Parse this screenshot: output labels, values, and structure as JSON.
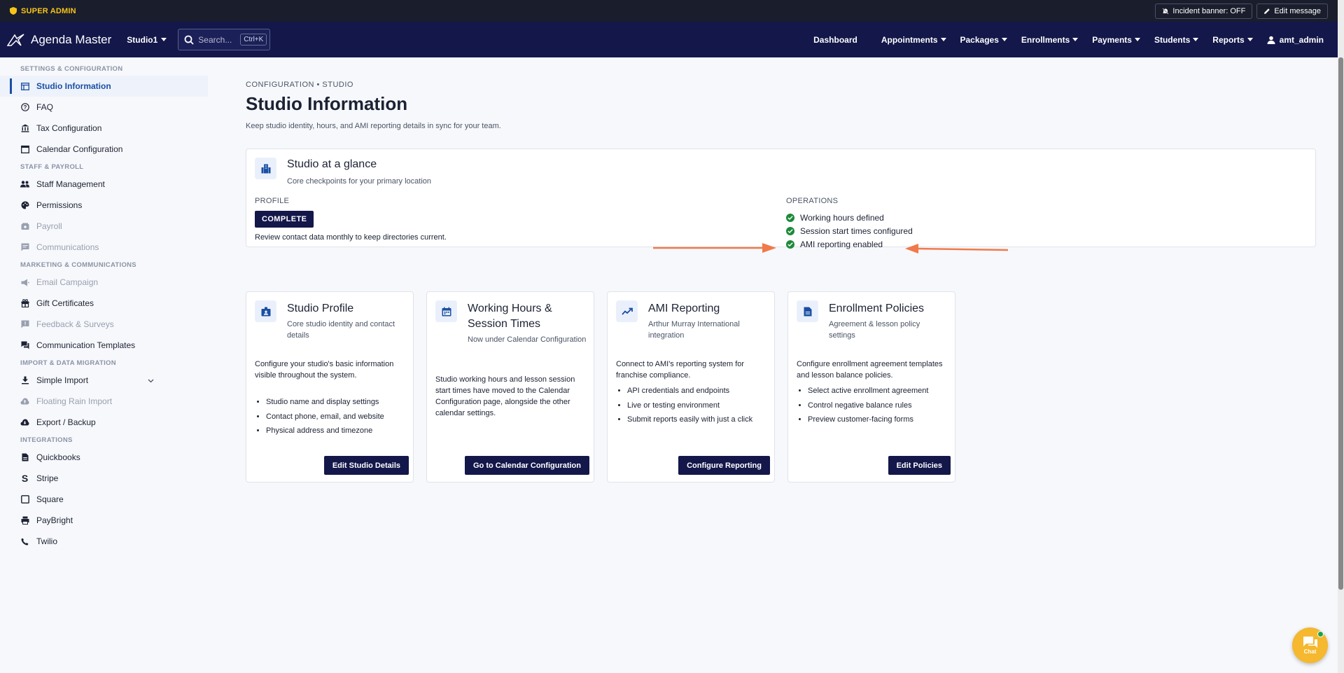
{
  "admin_bar": {
    "badge_label": "SUPER ADMIN",
    "incident_banner_label": "Incident banner: OFF",
    "edit_message_label": "Edit message"
  },
  "nav": {
    "brand": "Agenda Master",
    "studio": "Studio1",
    "search_placeholder": "Search...",
    "search_shortcut": "Ctrl+K",
    "links": {
      "dashboard": "Dashboard",
      "appointments": "Appointments",
      "packages": "Packages",
      "enrollments": "Enrollments",
      "payments": "Payments",
      "students": "Students",
      "reports": "Reports",
      "user": "amt_admin"
    }
  },
  "sidebar": {
    "sections": {
      "settings": "SETTINGS & CONFIGURATION",
      "staff": "STAFF & PAYROLL",
      "marketing": "MARKETING & COMMUNICATIONS",
      "import": "IMPORT & DATA MIGRATION",
      "integrations": "INTEGRATIONS"
    },
    "items": {
      "studio_information": "Studio Information",
      "faq": "FAQ",
      "tax_configuration": "Tax Configuration",
      "calendar_configuration": "Calendar Configuration",
      "staff_management": "Staff Management",
      "permissions": "Permissions",
      "payroll": "Payroll",
      "communications": "Communications",
      "email_campaign": "Email Campaign",
      "gift_certificates": "Gift Certificates",
      "feedback_surveys": "Feedback & Surveys",
      "communication_templates": "Communication Templates",
      "simple_import": "Simple Import",
      "floating_rain_import": "Floating Rain Import",
      "export_backup": "Export / Backup",
      "quickbooks": "Quickbooks",
      "stripe": "Stripe",
      "square": "Square",
      "paybright": "PayBright",
      "twilio": "Twilio"
    }
  },
  "page": {
    "breadcrumb": "CONFIGURATION • STUDIO",
    "title": "Studio Information",
    "subtitle": "Keep studio identity, hours, and AMI reporting details in sync for your team."
  },
  "glance": {
    "title": "Studio at a glance",
    "subtitle": "Core checkpoints for your primary location",
    "profile_label": "PROFILE",
    "profile_status": "COMPLETE",
    "profile_note": "Review contact data monthly to keep directories current.",
    "operations_label": "OPERATIONS",
    "operations": [
      "Working hours defined",
      "Session start times configured",
      "AMI reporting enabled"
    ]
  },
  "cards": {
    "studio_profile": {
      "title": "Studio Profile",
      "subtitle": "Core studio identity and contact details",
      "description": "Configure your studio's basic information visible throughout the system.",
      "bullets": [
        "Studio name and display settings",
        "Contact phone, email, and website",
        "Physical address and timezone"
      ],
      "button": "Edit Studio Details"
    },
    "working_hours": {
      "title": "Working Hours & Session Times",
      "subtitle": "Now under Calendar Configuration",
      "description": "Studio working hours and lesson session start times have moved to the Calendar Configuration page, alongside the other calendar settings.",
      "button": "Go to Calendar Configuration"
    },
    "ami_reporting": {
      "title": "AMI Reporting",
      "subtitle": "Arthur Murray International integration",
      "description": "Connect to AMI's reporting system for franchise compliance.",
      "bullets": [
        "API credentials and endpoints",
        "Live or testing environment",
        "Submit reports easily with just a click"
      ],
      "button": "Configure Reporting"
    },
    "enrollment_policies": {
      "title": "Enrollment Policies",
      "subtitle": "Agreement & lesson policy settings",
      "description": "Configure enrollment agreement templates and lesson balance policies.",
      "bullets": [
        "Select active enrollment agreement",
        "Control negative balance rules",
        "Preview customer-facing forms"
      ],
      "button": "Edit Policies"
    }
  },
  "chat": {
    "label": "Chat"
  },
  "colors": {
    "nav_bg": "#13174a",
    "accent": "#1a4fa3",
    "annotation_arrow": "#f07a4a",
    "chat": "#f5b82e",
    "success": "#1e8a3a"
  }
}
